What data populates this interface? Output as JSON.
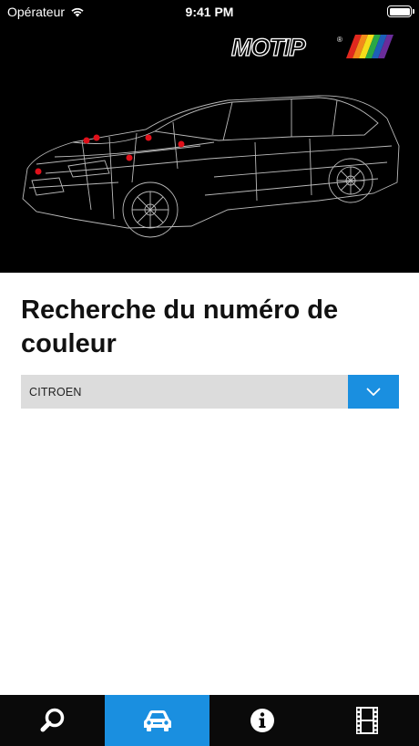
{
  "status_bar": {
    "carrier": "Opérateur",
    "time": "9:41 PM"
  },
  "brand": {
    "logo_text": "MOTIP"
  },
  "page": {
    "title": "Recherche du numéro de couleur"
  },
  "brand_select": {
    "selected": "CITROEN"
  },
  "tabbar": {
    "tabs": [
      {
        "icon": "search-icon",
        "active": false
      },
      {
        "icon": "car-icon",
        "active": true
      },
      {
        "icon": "info-icon",
        "active": false
      },
      {
        "icon": "film-icon",
        "active": false
      }
    ]
  },
  "colors": {
    "accent": "#1a8fe0",
    "hotspot": "#e0101a"
  }
}
